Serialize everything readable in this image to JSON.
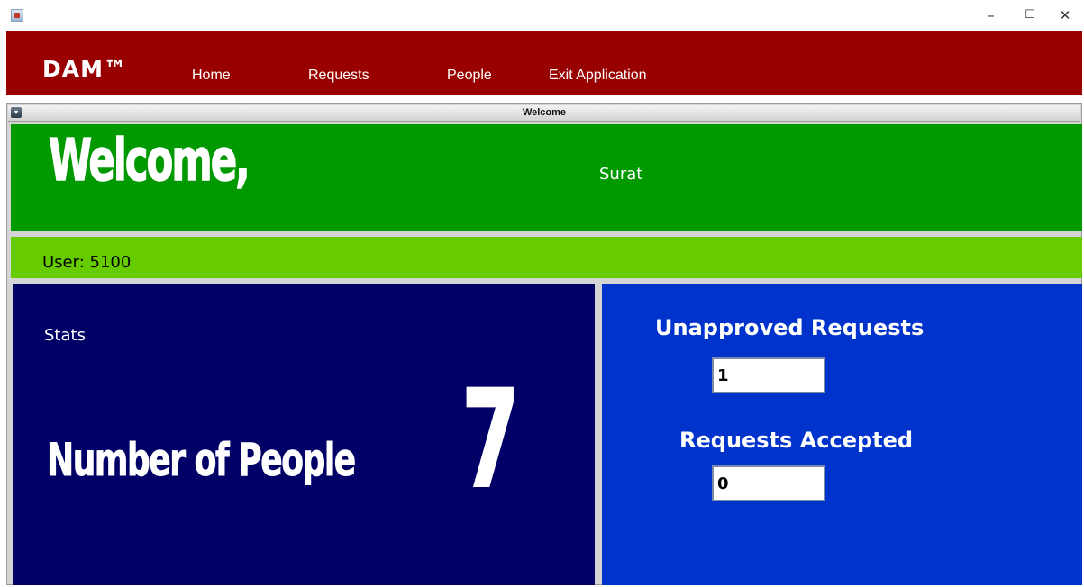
{
  "window": {
    "controls": {
      "minimize": "–",
      "maximize": "☐",
      "close": "✕"
    }
  },
  "menubar": {
    "logo": "DAM™",
    "items": [
      "Home",
      "Requests",
      "People",
      "Exit Application"
    ]
  },
  "internal_frame": {
    "title": "Welcome"
  },
  "welcome": {
    "heading": "Welcome,",
    "username": "Surat"
  },
  "user_bar": {
    "text": "User: 5100"
  },
  "stats": {
    "label": "Stats",
    "people_label": "Number of People",
    "people_count": "7"
  },
  "requests": {
    "unapproved_label": "Unapproved Requests",
    "unapproved_value": "1",
    "accepted_label": "Requests Accepted",
    "accepted_value": "0"
  },
  "colors": {
    "menubar": "#990000",
    "welcome_panel": "#009900",
    "user_bar": "#66cc00",
    "stats_panel": "#000066",
    "requests_panel": "#0033cc"
  }
}
